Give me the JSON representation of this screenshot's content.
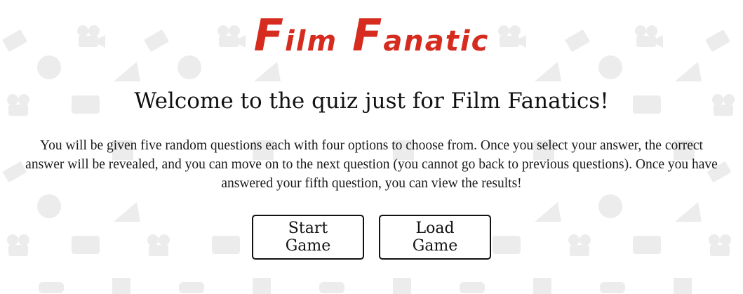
{
  "logo": {
    "text": "Film Fanatic",
    "color": "#d62b1f",
    "parts": {
      "f1": "F",
      "w1": "ilm",
      "f2": "F",
      "w2": "anatic"
    }
  },
  "welcome_heading": "Welcome to the quiz just for Film Fanatics!",
  "intro_text": "You will be given five random questions each with four options to choose from. Once you select your answer, the correct answer will be revealed, and you can move on to the next question (you cannot go back to previous questions). Once you have answered your fifth question, you can view the results!",
  "buttons": {
    "start_label": "Start Game",
    "load_label": "Load Game"
  },
  "background": {
    "pattern_icons": [
      "film-camera-icon",
      "film-reel-icon",
      "clapperboard-icon",
      "megaphone-icon",
      "popcorn-icon",
      "3d-glasses-icon",
      "speech-bubble-icon"
    ],
    "icon_color": "#ececec"
  }
}
